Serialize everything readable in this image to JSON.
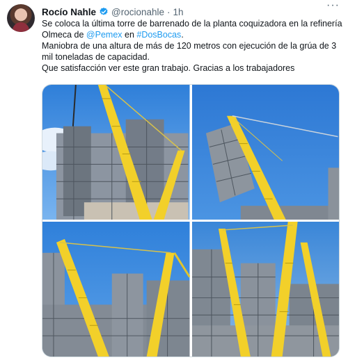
{
  "author": {
    "name": "Rocío Nahle",
    "handle": "@rocionahle",
    "separator": "·",
    "time": "1h",
    "more_label": "···"
  },
  "tweet": {
    "line1_pre": "Se coloca la última torre de barrenado de la planta coquizadora en la refinería Olmeca de ",
    "mention": "@Pemex",
    "line1_mid": " en ",
    "hashtag": "#DosBocas",
    "line1_post": ".",
    "line2": "Maniobra de una altura de más de 120 metros con ejecución de la grúa de 3 mil toneladas de capacidad.",
    "line3": "Que satisfacción ver este gran trabajo. Gracias a los trabajadores"
  },
  "colors": {
    "link": "#1d9bf0",
    "verified": "#1d9bf0",
    "crane": "#f2d02a",
    "sky": "#3f86de"
  },
  "photos": [
    {
      "name": "crane-photo-1"
    },
    {
      "name": "crane-photo-2"
    },
    {
      "name": "crane-photo-3"
    },
    {
      "name": "crane-photo-4"
    }
  ]
}
